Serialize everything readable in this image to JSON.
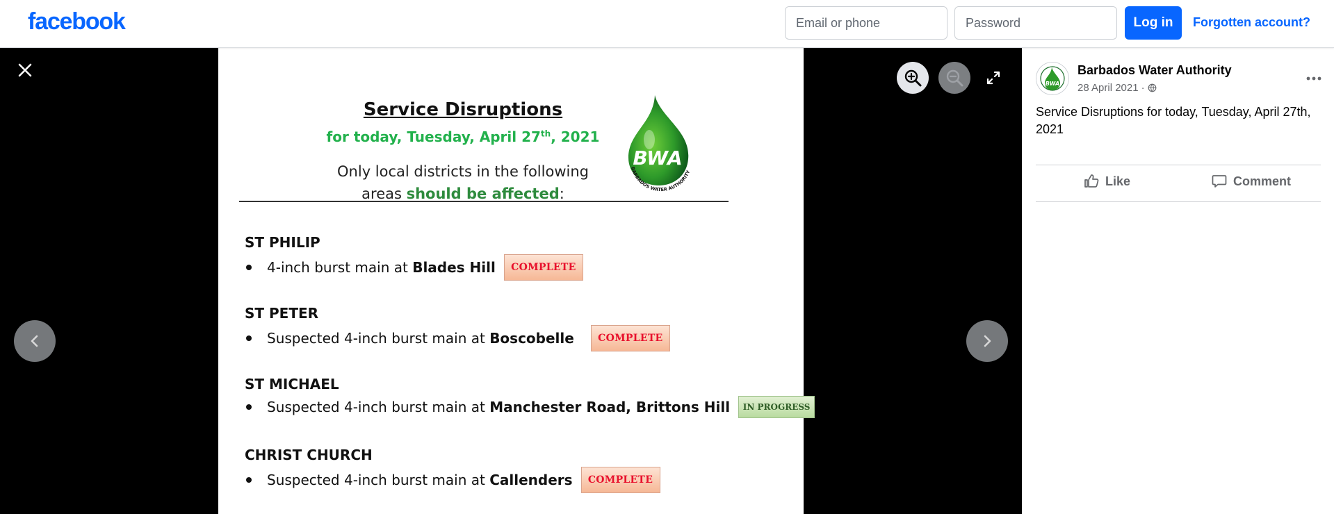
{
  "header": {
    "logo": "facebook",
    "email_placeholder": "Email or phone",
    "password_placeholder": "Password",
    "login_label": "Log in",
    "forgot_label": "Forgotten account?"
  },
  "viewer": {
    "icons": {
      "close": "close-icon",
      "zoom_in": "zoom-in-icon",
      "zoom_out": "zoom-out-icon",
      "fullscreen": "fullscreen-icon",
      "prev": "chevron-left-icon",
      "next": "chevron-right-icon"
    },
    "document": {
      "title": "Service Disruptions",
      "subtitle_pre": "for today, Tuesday, April 27",
      "subtitle_sup": "th",
      "subtitle_post": ", 2021",
      "note_line1": "Only local districts in the following",
      "note_line2_pre": "areas ",
      "note_line2_em": "should be affected",
      "note_line2_post": ":",
      "logo_text": "BWA",
      "logo_ring_text": "BARBADOS WATER AUTHORITY",
      "sections": [
        {
          "parish": "ST PHILIP",
          "text": "4-inch burst main at ",
          "place": "Blades Hill",
          "status": "COMPLETE"
        },
        {
          "parish": "ST PETER",
          "text": "Suspected 4-inch burst main at ",
          "place": "Boscobelle",
          "status": "COMPLETE"
        },
        {
          "parish": "ST MICHAEL",
          "text": "Suspected 4-inch burst main at ",
          "place": "Manchester Road, Brittons Hill",
          "status": "IN PROGRESS"
        },
        {
          "parish": "CHRIST CHURCH",
          "text": "Suspected 4-inch burst main at ",
          "place": "Callenders",
          "status": "COMPLETE"
        }
      ],
      "colors": {
        "green": "#22b14c",
        "complete_red": "#e8112d",
        "progress_green": "#2f5d27"
      }
    }
  },
  "post": {
    "page_name": "Barbados Water Authority",
    "date": "28 April 2021",
    "date_separator": "·",
    "privacy_icon": "globe-icon",
    "text": "Service Disruptions for today, Tuesday, April 27th, 2021",
    "like_label": "Like",
    "comment_label": "Comment"
  },
  "colors": {
    "brand_blue": "#0866ff",
    "viewer_bg": "#000000",
    "muted_text": "#65676b"
  }
}
